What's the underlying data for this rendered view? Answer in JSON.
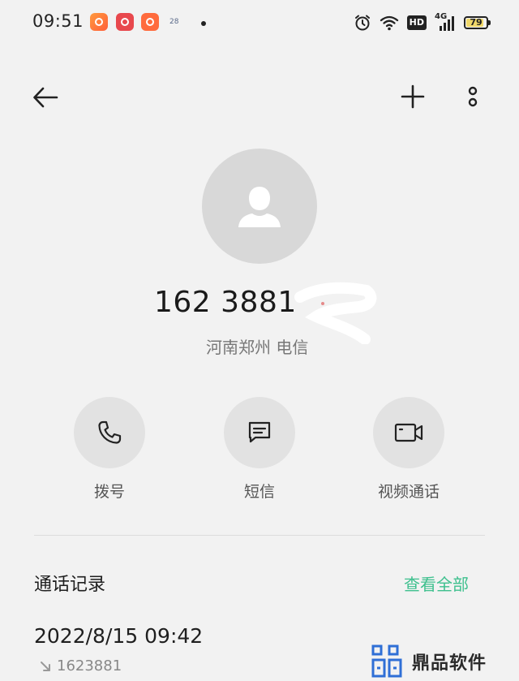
{
  "status_bar": {
    "time": "09:51",
    "small_icon_text": "28",
    "network": "4G",
    "hd": "HD",
    "battery": "79",
    "icons": [
      "alarm-icon",
      "wifi-icon",
      "hd-icon",
      "signal-icon",
      "battery-icon"
    ]
  },
  "toolbar": {
    "back_icon": "arrow-left-icon",
    "add_icon": "plus-icon",
    "more_icon": "more-vertical-icon"
  },
  "contact": {
    "number": "162 3881",
    "location": "河南郑州 电信"
  },
  "actions": [
    {
      "label": "拨号",
      "icon": "phone-icon"
    },
    {
      "label": "短信",
      "icon": "message-icon"
    },
    {
      "label": "视频通话",
      "icon": "video-icon"
    }
  ],
  "call_log": {
    "title": "通话记录",
    "view_all": "查看全部",
    "entries": [
      {
        "datetime": "2022/8/15 09:42",
        "number": "1623881",
        "direction_icon": "outgoing-call-arrow-icon"
      }
    ]
  },
  "watermark": {
    "text": "鼎品软件"
  },
  "colors": {
    "background": "#f2f2f2",
    "accent": "#3ec08e",
    "action_circle": "#e2e2e2",
    "avatar": "#d8d8d8"
  }
}
